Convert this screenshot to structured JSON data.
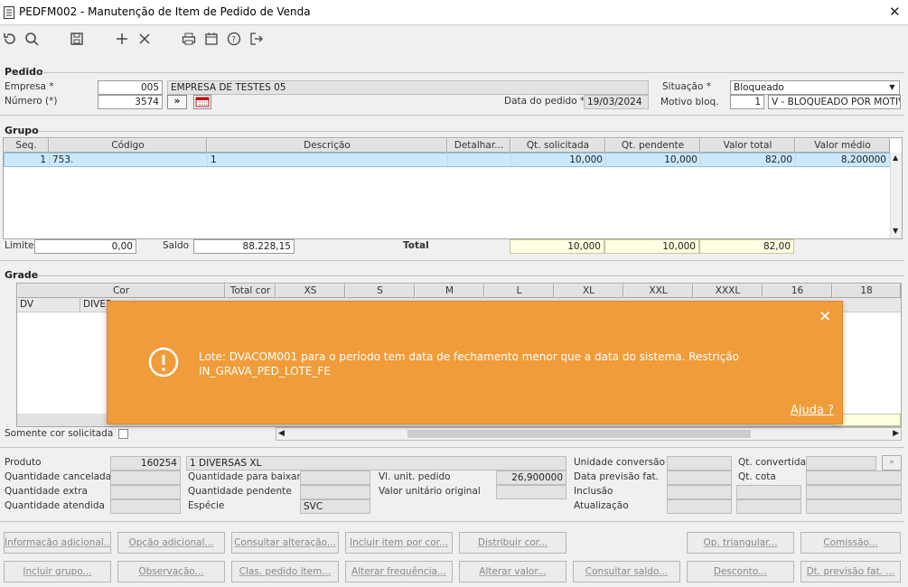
{
  "window": {
    "title": "PEDFM002 - Manutenção de Item de Pedido de Venda",
    "close": "✕"
  },
  "pedido": {
    "section": "Pedido",
    "empresa_label": "Empresa *",
    "empresa_code": "005",
    "empresa_name": "EMPRESA DE TESTES 05",
    "numero_label": "Número (*)",
    "numero": "3574",
    "next": "»",
    "data_label": "Data do pedido *",
    "data": "19/03/2024",
    "situacao_label": "Situação *",
    "situacao": "Bloqueado",
    "motivo_label": "Motivo bloq.",
    "motivo_code": "1",
    "motivo_desc": "V - BLOQUEADO POR MOTIVO"
  },
  "grupo": {
    "section": "Grupo",
    "columns": [
      "Seq.",
      "Código",
      "Descrição",
      "Detalhar...",
      "Qt. solicitada",
      "Qt. pendente",
      "Valor total",
      "Valor médio"
    ],
    "row": {
      "seq": "1",
      "codigo": "753.",
      "descricao": "1",
      "detalhar": "",
      "qt_solicitada": "10,000",
      "qt_pendente": "10,000",
      "valor_total": "82,00",
      "valor_medio": "8,200000"
    },
    "limite_label": "Limite",
    "limite": "0,00",
    "saldo_label": "Saldo",
    "saldo": "88.228,15",
    "total_label": "Total",
    "total_qt_sol": "10,000",
    "total_qt_pend": "10,000",
    "total_valor": "82,00"
  },
  "grade": {
    "section": "Grade",
    "columns": [
      "Cor",
      "Total cor",
      "XS",
      "S",
      "M",
      "L",
      "XL",
      "XXL",
      "XXXL",
      "16",
      "18"
    ],
    "row": {
      "code": "DV",
      "cor": "DIVER"
    },
    "somente_label": "Somente cor solicitada"
  },
  "toast": {
    "message": "Lote: DVACOM001 para o período tem data de fechamento menor que a data do sistema. Restrição IN_GRAVA_PED_LOTE_FE",
    "help": "Ajuda ?",
    "close": "✕"
  },
  "produto": {
    "produto_label": "Produto",
    "produto_code": "160254",
    "produto_desc": "1 DIVERSAS XL",
    "qt_cancelada_label": "Quantidade cancelada",
    "qt_extra_label": "Quantidade extra",
    "qt_atendida_label": "Quantidade atendida",
    "qt_baixar_label": "Quantidade para baixar",
    "qt_pendente_label": "Quantidade pendente",
    "especie_label": "Espécie",
    "especie": "SVC",
    "vl_unit_label": "Vl. unit. pedido",
    "vl_unit": "26,900000",
    "vl_orig_label": "Valor unitário original",
    "unid_conv_label": "Unidade conversão",
    "data_prev_label": "Data previsão fat.",
    "inclusao_label": "Inclusão",
    "atualizacao_label": "Atualização",
    "qt_convertida_label": "Qt. convertida",
    "qt_cota_label": "Qt. cota"
  },
  "buttons": {
    "row1": [
      "Informação adicional...",
      "Opção adicional...",
      "Consultar alteração...",
      "Incluir item por cor...",
      "Distribuir cor...",
      "Op. triangular...",
      "Comissão..."
    ],
    "row2": [
      "Incluir grupo...",
      "Observação...",
      "Clas. pedido item...",
      "Alterar frequência...",
      "Alterar valor...",
      "Consultar saldo...",
      "Desconto...",
      "Dt. previsão fat. ..."
    ]
  },
  "colors": {
    "toast": "#f09c3a",
    "selected_row": "#cce8fb",
    "total_yellow": "#ffffe1"
  }
}
